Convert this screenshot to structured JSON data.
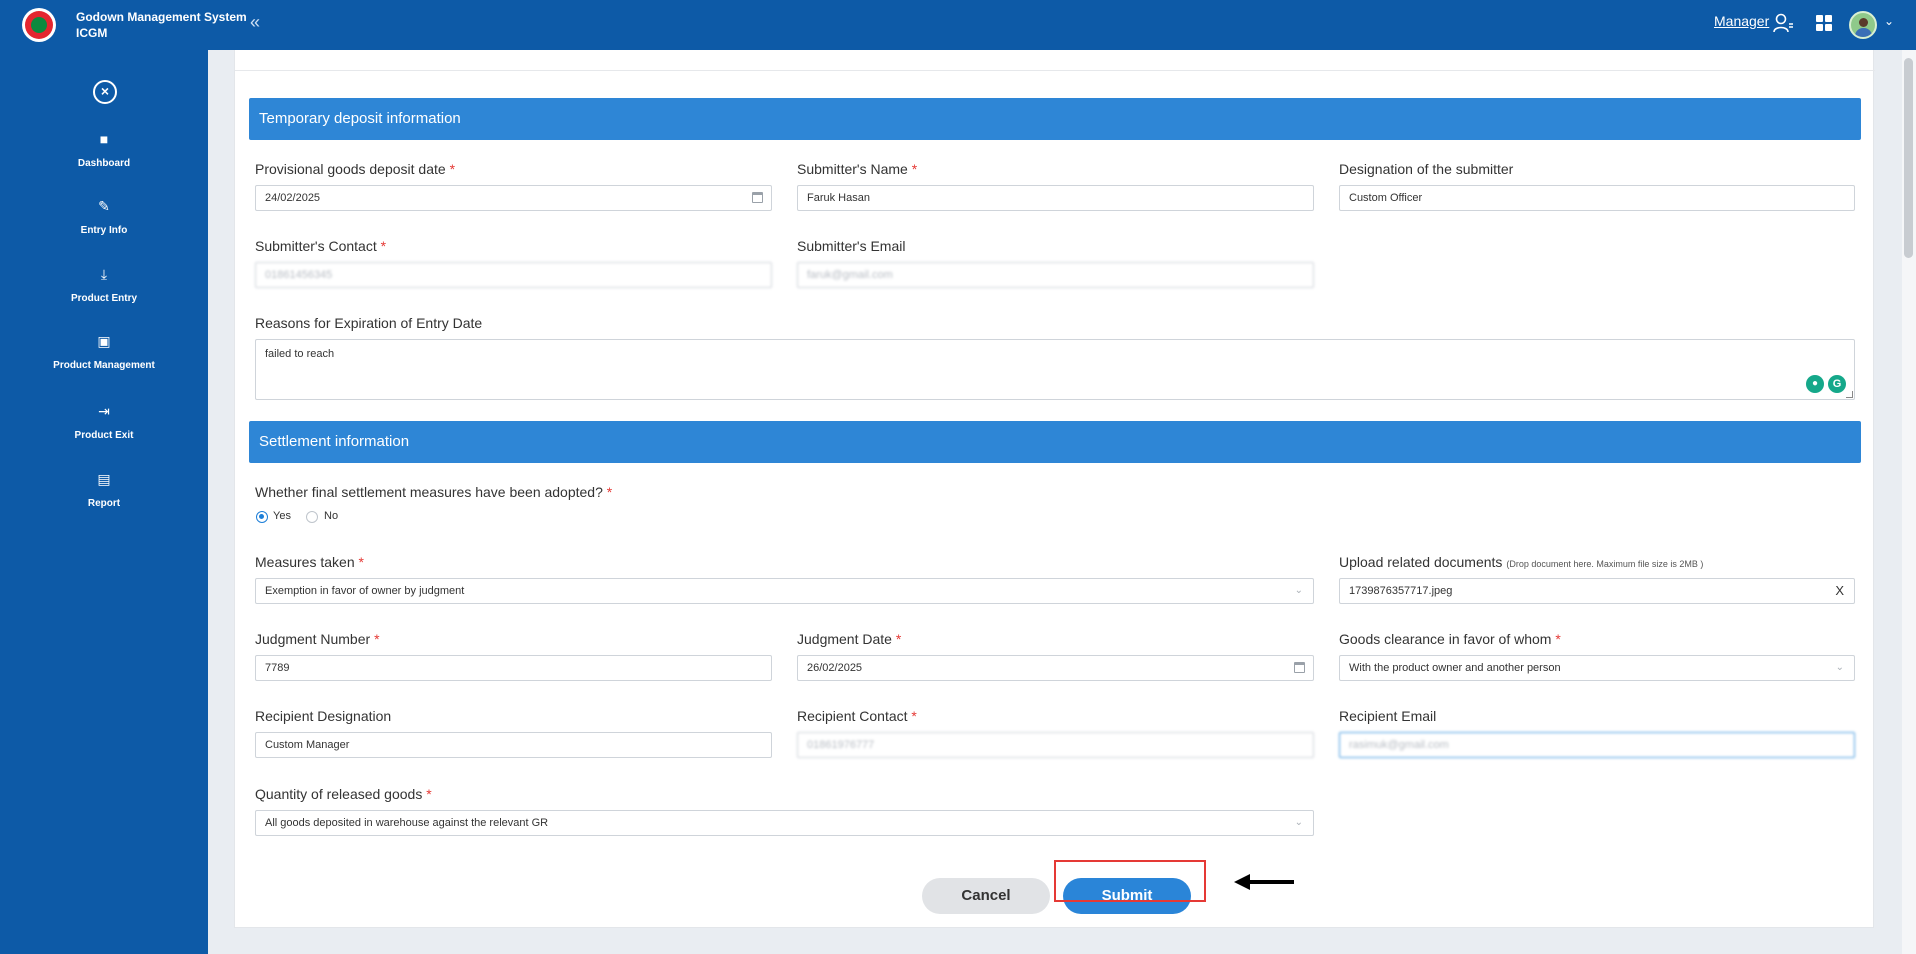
{
  "header": {
    "app_title": "Godown Management System",
    "app_subtitle": "ICGM",
    "collapse_icon": "«",
    "user_role": "Manager",
    "icons": [
      "logo",
      "switch-user-icon",
      "apps-grid-icon",
      "avatar",
      "chevron-down-icon"
    ]
  },
  "sidebar": {
    "items": [
      {
        "label": "Dashboard",
        "icon": "dashboard-icon"
      },
      {
        "label": "Entry Info",
        "icon": "entry-info-icon"
      },
      {
        "label": "Product Entry",
        "icon": "download-icon"
      },
      {
        "label": "Product Management",
        "icon": "management-icon"
      },
      {
        "label": "Product Exit",
        "icon": "exit-icon"
      },
      {
        "label": "Report",
        "icon": "report-icon"
      }
    ]
  },
  "temporary": {
    "title": "Temporary deposit information",
    "deposit_date": {
      "label": "Provisional goods deposit date",
      "value": "24/02/2025"
    },
    "submitter_name": {
      "label": "Submitter's Name",
      "value": "Faruk Hasan"
    },
    "designation": {
      "label": "Designation of the submitter",
      "value": "Custom Officer"
    },
    "contact": {
      "label": "Submitter's Contact",
      "value": "01861456345"
    },
    "email": {
      "label": "Submitter's Email",
      "value": "faruk@gmail.com"
    },
    "reasons": {
      "label": "Reasons for Expiration of Entry Date",
      "value": "failed to reach"
    }
  },
  "settlement": {
    "title": "Settlement information",
    "final_measures": {
      "label": "Whether final settlement measures have been adopted?",
      "yes": "Yes",
      "no": "No",
      "selected": "Yes"
    },
    "measures_taken": {
      "label": "Measures taken",
      "value": "Exemption in favor of owner by judgment"
    },
    "upload": {
      "label": "Upload related documents",
      "hint": "(Drop document here. Maximum file size is 2MB )",
      "value": "1739876357717.jpeg",
      "clear": "X"
    },
    "judgment_number": {
      "label": "Judgment Number",
      "value": "7789"
    },
    "judgment_date": {
      "label": "Judgment Date",
      "value": "26/02/2025"
    },
    "clearance": {
      "label": "Goods clearance in favor of whom",
      "value": "With the product owner and another person"
    },
    "recipient_designation": {
      "label": "Recipient Designation",
      "value": "Custom Manager"
    },
    "recipient_contact": {
      "label": "Recipient Contact",
      "value": "01861976777"
    },
    "recipient_email": {
      "label": "Recipient Email",
      "value": "rasimuk@gmail.com"
    },
    "quantity": {
      "label": "Quantity of released goods",
      "value": "All goods deposited in warehouse against the relevant GR"
    }
  },
  "actions": {
    "cancel": "Cancel",
    "submit": "Submit"
  },
  "required_mark": "*",
  "colors": {
    "brand": "#0d5aa7",
    "section": "#2e86d6",
    "submit": "#2a85d8",
    "highlight": "#e53935"
  }
}
